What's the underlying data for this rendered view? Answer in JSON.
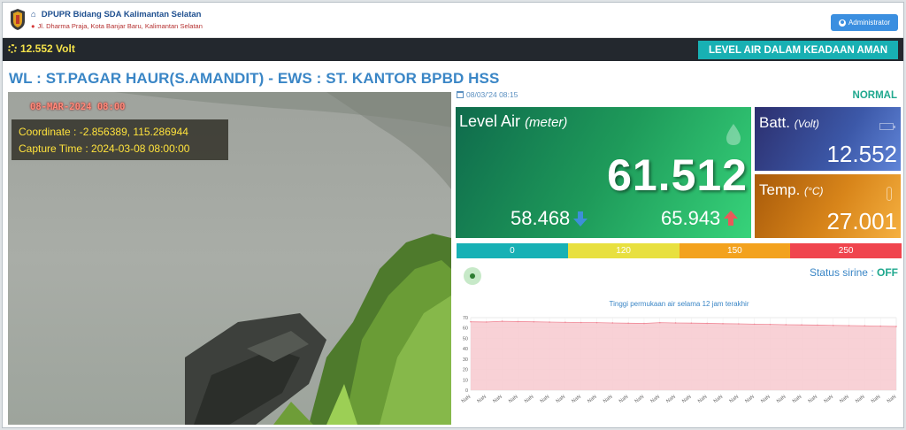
{
  "header": {
    "org_name": "DPUPR Bidang SDA Kalimantan Selatan",
    "address": "Jl. Dharma Praja, Kota Banjar Baru, Kalimantan Selatan",
    "admin_label": "Administrator"
  },
  "statusbar": {
    "voltage": "12.552 Volt",
    "alert": "LEVEL AIR DALAM KEADAAN AMAN"
  },
  "title": "WL : ST.PAGAR HAUR(S.AMANDIT) - EWS : ST. KANTOR BPBD HSS",
  "camera": {
    "stamp": "08-MAR-2024 08:00",
    "coordinate": "Coordinate : -2.856389, 115.286944",
    "capture": "Capture Time : 2024-03-08 08:00:00"
  },
  "panel": {
    "timestamp": "08/03/'24 08:15",
    "status": "NORMAL",
    "level_label": "Level Air",
    "level_unit": "(meter)",
    "level_value": "61.512",
    "level_min": "58.468",
    "level_max": "65.943",
    "batt_label": "Batt.",
    "batt_unit": "(Volt)",
    "batt_value": "12.552",
    "temp_label": "Temp.",
    "temp_unit": "(°C)",
    "temp_value": "27.001"
  },
  "thresholds": [
    {
      "label": "0",
      "color": "#17b1b5"
    },
    {
      "label": "120",
      "color": "#e8e040"
    },
    {
      "label": "150",
      "color": "#f3a21e"
    },
    {
      "label": "250",
      "color": "#f0454e"
    }
  ],
  "siren": {
    "label": "Status sirine :",
    "value": "OFF"
  },
  "colors": {
    "accent_blue": "#3a86c6",
    "safe_teal": "#18b0b3",
    "normal_green": "#1fa88e"
  },
  "chart_data": {
    "type": "area",
    "title": "Tinggi permukaan air selama 12 jam terakhir",
    "ylim": [
      0,
      70
    ],
    "yticks": [
      0,
      10,
      20,
      30,
      40,
      50,
      60,
      70
    ],
    "x": [
      "NaN",
      "NaN",
      "NaN",
      "NaN",
      "NaN",
      "NaN",
      "NaN",
      "NaN",
      "NaN",
      "NaN",
      "NaN",
      "NaN",
      "NaN",
      "NaN",
      "NaN",
      "NaN",
      "NaN",
      "NaN",
      "NaN",
      "NaN",
      "NaN",
      "NaN",
      "NaN",
      "NaN",
      "NaN",
      "NaN",
      "NaN",
      "NaN"
    ],
    "values": [
      66.0,
      65.8,
      66.5,
      66.2,
      66.0,
      65.7,
      65.5,
      65.3,
      65.2,
      64.9,
      64.6,
      64.4,
      65.2,
      64.9,
      64.7,
      64.5,
      64.2,
      64.0,
      63.7,
      63.5,
      63.2,
      63.0,
      62.8,
      62.5,
      62.3,
      62.1,
      61.8,
      61.5
    ],
    "grid": true
  }
}
